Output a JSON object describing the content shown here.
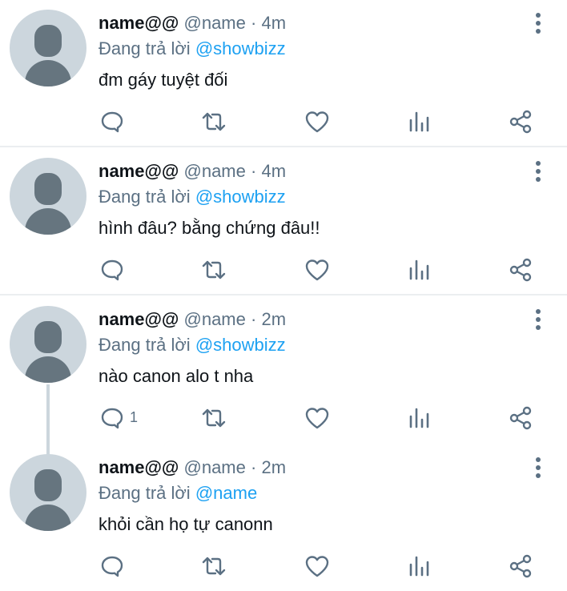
{
  "tweets": [
    {
      "display_name": "name@@",
      "handle": "@name",
      "separator": "·",
      "time": "4m",
      "replying_prefix": "Đang trả lời",
      "replying_to": "@showbizz",
      "text": "đm gáy tuyệt đối",
      "reply_count": ""
    },
    {
      "display_name": "name@@",
      "handle": "@name",
      "separator": "·",
      "time": "4m",
      "replying_prefix": "Đang trả lời",
      "replying_to": "@showbizz",
      "text": "hình đâu? bằng chứng đâu!!",
      "reply_count": ""
    },
    {
      "display_name": "name@@",
      "handle": "@name",
      "separator": "·",
      "time": "2m",
      "replying_prefix": "Đang trả lời",
      "replying_to": "@showbizz",
      "text": "nào canon alo t nha",
      "reply_count": "1"
    },
    {
      "display_name": "name@@",
      "handle": "@name",
      "separator": "·",
      "time": "2m",
      "replying_prefix": "Đang trả lời",
      "replying_to": "@name",
      "text": "khỏi cần họ tự canonn",
      "reply_count": ""
    }
  ],
  "action_icons": [
    "reply-icon",
    "retweet-icon",
    "like-icon",
    "analytics-icon",
    "share-icon"
  ],
  "colors": {
    "text": "#0f1419",
    "secondary": "#5b7083",
    "mention": "#1da1f2",
    "avatar_bg": "#ccd6dd",
    "avatar_fg": "#66757f",
    "divider": "#ebeef0"
  }
}
